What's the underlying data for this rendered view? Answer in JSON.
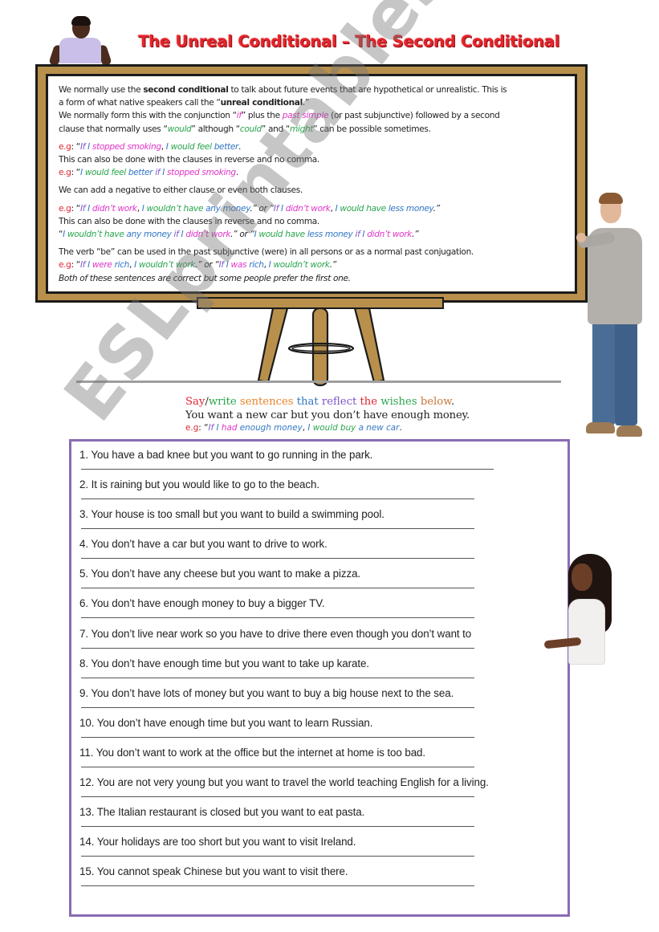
{
  "title": "The Unreal Conditional – The Second Conditional",
  "board": {
    "intro": {
      "l1_a": "We normally use the ",
      "l1_b": "second conditional",
      "l1_c": " to talk about future events that are hypothetical or unrealistic. This is",
      "l2_a": "a form of what native speakers call the “",
      "l2_b": "unreal conditional",
      "l2_c": ".”",
      "l3_a": "We normally form this with the conjunction “",
      "l3_if": "if",
      "l3_b": "” plus the ",
      "l3_ps": "past simple",
      "l3_c": " (or past subjunctive) followed by a second",
      "l4_a": "clause that normally uses “",
      "l4_would": "would",
      "l4_b": "” although “",
      "l4_could": "could",
      "l4_c": "” and “",
      "l4_might": "might",
      "l4_d": "” can be possible sometimes."
    },
    "example1": {
      "eg": "e.g",
      "q": ": “",
      "if": "If ",
      "i": "I ",
      "stopped": "stopped smoking",
      "comma": ", ",
      "i2": "I ",
      "would": "would feel ",
      "better": "better",
      "end": "."
    },
    "reverse_note": "This can also be done with the clauses in reverse and no comma.",
    "example2": {
      "eg": "e.g",
      "q": ": “",
      "i": "I ",
      "would": "would feel ",
      "better": "better ",
      "if": "if ",
      "i2": "I ",
      "stopped": "stopped smoking",
      "end": "."
    },
    "negative_note": "We can add a negative to either clause or even both clauses.",
    "example3": {
      "eg": "e.g",
      "q": ": “",
      "a_if": "If ",
      "a_i": "I ",
      "a_didnt": "didn’t work",
      "a_comma": ", ",
      "a_i2": "I ",
      "a_wouldnt": "wouldn’t have ",
      "a_money": "any money",
      "a_end": ".” or “",
      "b_if": "If ",
      "b_i": "I ",
      "b_didnt": "didn’t work",
      "b_comma": ", ",
      "b_i2": "I ",
      "b_would": "would have ",
      "b_money": "less money",
      "b_end": ".”"
    },
    "reverse_note2": "This can also be done with the clauses in reverse and no comma.",
    "example4": {
      "q": " “",
      "a_i": "I ",
      "a_wouldnt": "wouldn’t have ",
      "a_money": "any money ",
      "a_if": "if ",
      "a_i2": "I ",
      "a_didnt": "didn’t work",
      "a_end": ".” or “",
      "b_i": "I ",
      "b_would": "would have ",
      "b_money": "less money ",
      "b_if": "if ",
      "b_i2": "I ",
      "b_didnt": "didn’t work",
      "b_end": ".”"
    },
    "be_note": "The verb “be” can be used in the past subjunctive (were) in all persons or as a normal past conjugation.",
    "example5": {
      "eg": "e.g",
      "q": ": “",
      "a_if": "If ",
      "a_i": "I ",
      "a_were": "were ",
      "a_rich": "rich",
      "a_comma": ", ",
      "a_i2": "I ",
      "a_wouldnt": "wouldn’t work",
      "a_end": ".” or “",
      "b_if": "If ",
      "b_i": "I ",
      "b_was": "was ",
      "b_rich": "rich",
      "b_comma": ", ",
      "b_i2": "I ",
      "b_wouldnt": "wouldn’t work",
      "b_end": ".”"
    },
    "both_note": "Both of these sentences are correct but some people prefer the first one."
  },
  "instructions": {
    "words": [
      {
        "text": "Say",
        "color": "#e0262f"
      },
      {
        "text": "/",
        "color": "#333333"
      },
      {
        "text": "write ",
        "color": "#2aa54d"
      },
      {
        "text": "sentences ",
        "color": "#e8832a"
      },
      {
        "text": "that ",
        "color": "#3277c4"
      },
      {
        "text": "reflect ",
        "color": "#7c55c9"
      },
      {
        "text": "the ",
        "color": "#e0262f"
      },
      {
        "text": "wishes ",
        "color": "#2aa54d"
      },
      {
        "text": "below",
        "color": "#c9773a"
      },
      {
        "text": ".",
        "color": "#333333"
      }
    ],
    "situation": "You want a new car but you don’t have enough money.",
    "example": {
      "eg": "e.g",
      "q": ": “",
      "if": "If ",
      "i": "I ",
      "had": "had ",
      "money": "enough money",
      "comma": ", ",
      "i2": "I ",
      "would": "would ",
      "buy": "buy ",
      "car": "a new car",
      "end": "."
    }
  },
  "exercises": [
    "1. You have a bad knee but you want to go running in the park.",
    "2. It is raining but you would like to go to the beach.",
    "3. Your house is too small but you want to build a swimming pool.",
    "4. You don’t have a car but you want to drive to work.",
    "5. You don’t have any cheese but you want to make a pizza.",
    "6. You don’t have enough money to buy a bigger TV.",
    "7. You don’t live near work so you have to drive there even though you don’t want to",
    "8. You don’t have enough time but you want to take up karate.",
    "9. You don’t have lots of money but you want to buy a big house next to the sea.",
    "10. You don’t have enough time but you want to learn Russian.",
    "11. You don’t want to work at the office but the internet at home is too bad.",
    "12. You are not very young but you want to travel the world teaching English for a living.",
    "13. The Italian restaurant is closed but you want to eat pasta.",
    "14. Your holidays are too short but you want to visit Ireland.",
    "15. You cannot speak Chinese but you want to visit there."
  ],
  "watermark": "ESLprintables.com",
  "colors": {
    "title_red": "#e5242b",
    "easel_wood": "#b8904c",
    "worksheet_border": "#8a6bb5",
    "eg_red": "#e0262f",
    "magenta": "#e033c8",
    "green": "#2aa54d",
    "blue": "#3277c4",
    "purple": "#7c55c9"
  }
}
